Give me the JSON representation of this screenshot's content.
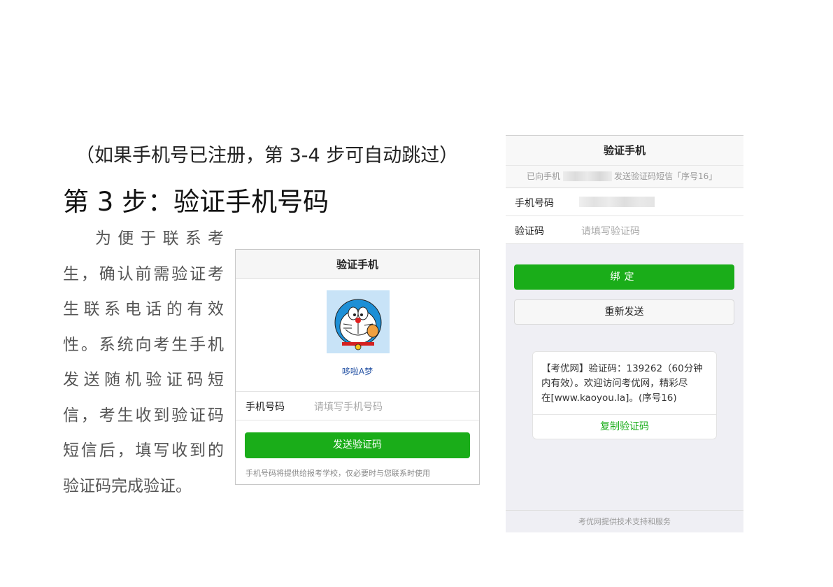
{
  "doc": {
    "subtitle": "（如果手机号已注册，第 3-4 步可自动跳过）",
    "heading": "第 3 步：验证手机号码",
    "paragraph_lines": [
      "为便于联系考",
      "生，确认前需验证考",
      "生联系电话的有效",
      "性。系统向考生手机",
      "发送随机验证码短",
      "信，考生收到验证码",
      "短信后，填写收到的",
      "验证码完成验证。"
    ]
  },
  "screen1": {
    "title": "验证手机",
    "avatar_icon": "doraemon-avatar",
    "nickname": "哆啦A梦",
    "phone_label": "手机号码",
    "phone_placeholder": "请填写手机号码",
    "send_button": "发送验证码",
    "note": "手机号码将提供给报考学校，仅必要时与您联系时使用"
  },
  "screen2": {
    "title": "验证手机",
    "notice_prefix": "已向手机",
    "notice_suffix": "发送验证码短信「序号16」",
    "phone_label": "手机号码",
    "code_label": "验证码",
    "code_placeholder": "请填写验证码",
    "bind_button": "绑定",
    "resend_button": "重新发送",
    "sms_lines": [
      "【考优网】验证码：139262（60分钟",
      "内有效）。欢迎访问考优网，精彩尽",
      "在[www.kaoyou.la]。(序号16)"
    ],
    "copy_button": "复制验证码",
    "footer": "考优网提供技术支持和服务"
  },
  "colors": {
    "primary_green": "#1aad19",
    "link_blue": "#2a56a6"
  }
}
